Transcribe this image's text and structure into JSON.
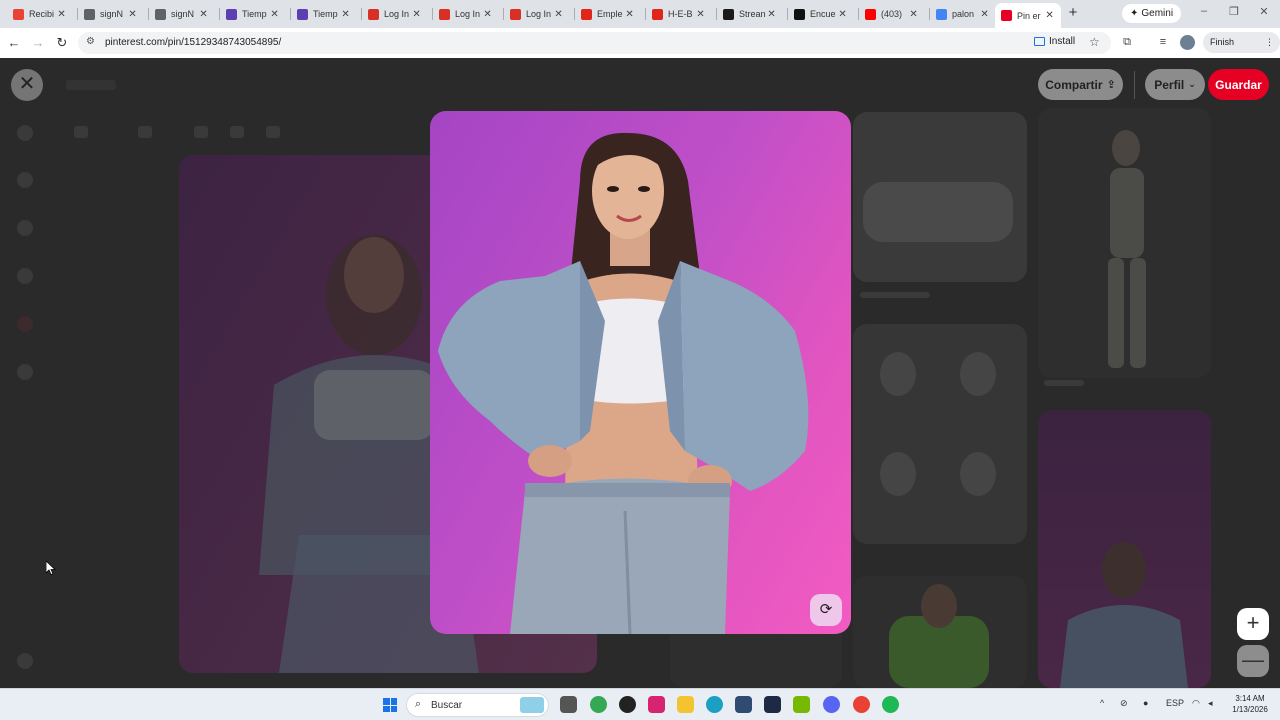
{
  "browser": {
    "tabs": [
      {
        "label": "Recibi",
        "favicon": "gmail-icon",
        "color": "#ea4335"
      },
      {
        "label": "signN",
        "favicon": "globe-icon",
        "color": "#5f6368"
      },
      {
        "label": "signN",
        "favicon": "globe-icon",
        "color": "#5f6368"
      },
      {
        "label": "Tiemp",
        "favicon": "teams-icon",
        "color": "#5b3fb3"
      },
      {
        "label": "Tiemp",
        "favicon": "teams-icon",
        "color": "#5b3fb3"
      },
      {
        "label": "Log In",
        "favicon": "login-icon",
        "color": "#d93025"
      },
      {
        "label": "Log In",
        "favicon": "login-icon",
        "color": "#d93025"
      },
      {
        "label": "Log In",
        "favicon": "login-icon",
        "color": "#d93025"
      },
      {
        "label": "Emple",
        "favicon": "heb-icon",
        "color": "#e1251b"
      },
      {
        "label": "H-E-B",
        "favicon": "heb-icon",
        "color": "#e1251b"
      },
      {
        "label": "Strean",
        "favicon": "kick-icon",
        "color": "#1a1a1a"
      },
      {
        "label": "Encue",
        "favicon": "tiktok-icon",
        "color": "#111111"
      },
      {
        "label": "(403)",
        "favicon": "youtube-icon",
        "color": "#ff0000"
      },
      {
        "label": "palon",
        "favicon": "google-icon",
        "color": "#4285f4"
      },
      {
        "label": "Pin er",
        "favicon": "pinterest-icon",
        "color": "#e60023"
      }
    ],
    "gemini_label": "Gemini",
    "url": "pinterest.com/pin/15129348743054895/",
    "install_label": "Install",
    "finish_update_label": "Finish update"
  },
  "pin": {
    "share_label": "Compartir",
    "profile_label": "Perfil",
    "save_label": "Guardar"
  },
  "taskbar": {
    "search_placeholder": "Buscar",
    "language": "ESP",
    "time": "3:14 AM",
    "date": "1/13/2026"
  },
  "colors": {
    "pinterest_red": "#e60023",
    "photo_bg": "#d04fc4"
  }
}
